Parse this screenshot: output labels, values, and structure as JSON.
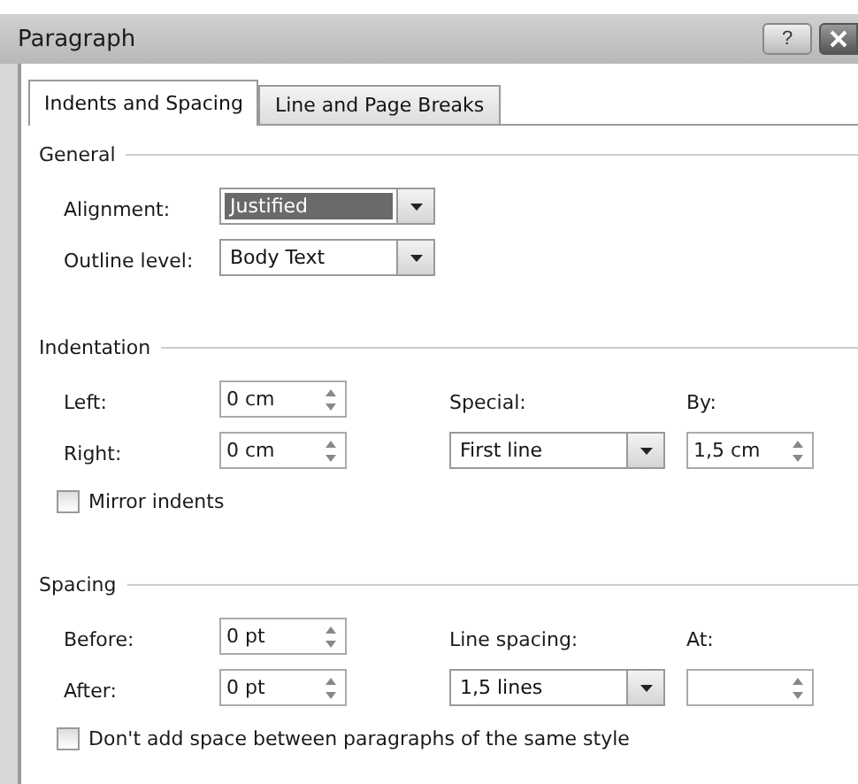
{
  "window": {
    "title": "Paragraph",
    "help_button": "?"
  },
  "tabs": [
    {
      "label": "Indents and Spacing",
      "selected": true
    },
    {
      "label": "Line and Page Breaks",
      "selected": false
    }
  ],
  "sections": [
    {
      "title": "General",
      "rows": [
        [
          {
            "kind": "label",
            "text": "Alignment:"
          },
          {
            "kind": "combo",
            "value": "Justified",
            "focused": true
          }
        ],
        [
          {
            "kind": "label",
            "text": "Outline level:"
          },
          {
            "kind": "combo",
            "value": "Body Text",
            "focused": false
          }
        ]
      ]
    },
    {
      "title": "Indentation",
      "rows": [
        [
          {
            "kind": "label",
            "text": "Left:"
          },
          {
            "kind": "spin",
            "value": "0 cm"
          },
          {
            "kind": "label",
            "text": "Special:"
          },
          {
            "kind": "label",
            "text": "By:"
          }
        ],
        [
          {
            "kind": "label",
            "text": "Right:"
          },
          {
            "kind": "spin",
            "value": "0 cm"
          },
          {
            "kind": "combo",
            "value": "First line",
            "focused": false
          },
          {
            "kind": "spin",
            "value": "1,5 cm"
          }
        ],
        [
          {
            "kind": "checkbox",
            "text": "Mirror indents",
            "checked": false
          }
        ]
      ]
    },
    {
      "title": "Spacing",
      "rows": [
        [
          {
            "kind": "label",
            "text": "Before:"
          },
          {
            "kind": "spin",
            "value": "0 pt"
          },
          {
            "kind": "label",
            "text": "Line spacing:"
          },
          {
            "kind": "label",
            "text": "At:"
          }
        ],
        [
          {
            "kind": "label",
            "text": "After:"
          },
          {
            "kind": "spin",
            "value": "0 pt"
          },
          {
            "kind": "combo",
            "value": "1,5 lines",
            "focused": false
          },
          {
            "kind": "spin"
          }
        ],
        [
          {
            "kind": "checkbox",
            "text": "Don't add space between paragraphs of the same style",
            "checked": false
          }
        ]
      ]
    }
  ]
}
